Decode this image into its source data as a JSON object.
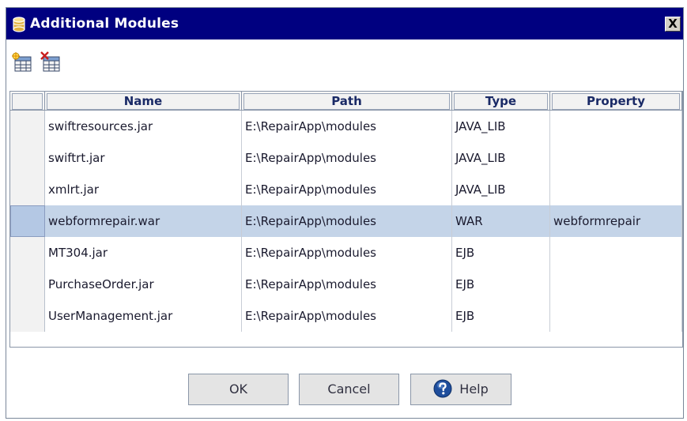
{
  "window": {
    "title": "Additional Modules",
    "close_glyph": "X"
  },
  "toolbar": {
    "icons": [
      "add-module-icon",
      "remove-module-icon"
    ]
  },
  "table": {
    "columns": [
      "Name",
      "Path",
      "Type",
      "Property"
    ],
    "rows": [
      {
        "name": "swiftresources.jar",
        "path": "E:\\RepairApp\\modules",
        "type": "JAVA_LIB",
        "property": ""
      },
      {
        "name": "swiftrt.jar",
        "path": "E:\\RepairApp\\modules",
        "type": "JAVA_LIB",
        "property": ""
      },
      {
        "name": "xmlrt.jar",
        "path": "E:\\RepairApp\\modules",
        "type": "JAVA_LIB",
        "property": ""
      },
      {
        "name": "webformrepair.war",
        "path": "E:\\RepairApp\\modules",
        "type": "WAR",
        "property": "webformrepair"
      },
      {
        "name": "MT304.jar",
        "path": "E:\\RepairApp\\modules",
        "type": "EJB",
        "property": ""
      },
      {
        "name": "PurchaseOrder.jar",
        "path": "E:\\RepairApp\\modules",
        "type": "EJB",
        "property": ""
      },
      {
        "name": "UserManagement.jar",
        "path": "E:\\RepairApp\\modules",
        "type": "EJB",
        "property": ""
      }
    ],
    "selected_row": 3
  },
  "buttons": {
    "ok": "OK",
    "cancel": "Cancel",
    "help": "Help"
  },
  "colors": {
    "titlebar": "#000080",
    "selection": "#c4d4e8",
    "header_text": "#1a2a66"
  }
}
